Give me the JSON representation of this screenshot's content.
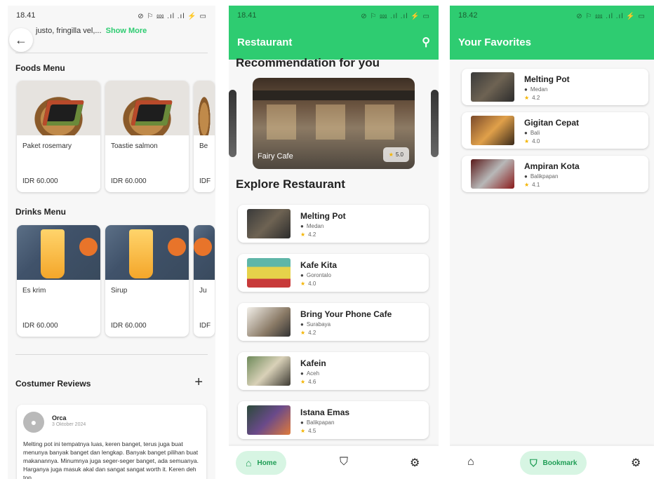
{
  "screen1": {
    "status_time": "18.41",
    "status_icons": "⊘ ⚐ ⅏ .ıl .ıl ⚡ ▭",
    "description_snippet": "justo, fringilla vel,...",
    "show_more": "Show More",
    "foods_title": "Foods Menu",
    "foods": [
      {
        "name": "Paket rosemary",
        "price": "IDR 60.000"
      },
      {
        "name": "Toastie salmon",
        "price": "IDR 60.000"
      },
      {
        "name": "Be",
        "price": "IDF"
      }
    ],
    "drinks_title": "Drinks Menu",
    "drinks": [
      {
        "name": "Es krim",
        "price": "IDR 60.000"
      },
      {
        "name": "Sirup",
        "price": "IDR 60.000"
      },
      {
        "name": "Ju",
        "price": "IDF"
      }
    ],
    "reviews_title": "Costumer Reviews",
    "review": {
      "name": "Orca",
      "date": "3 Oktober 2024",
      "text": "Melting pot ini tempatnya luas, keren banget, terus juga buat menunya banyak banget dan lengkap. Banyak banget pilihan buat makanannya. Minumnya juga seger-seger banget, ada semuanya. Harganya juga masuk akal dan sangat sangat worth it. Keren deh top"
    }
  },
  "screen2": {
    "status_time": "18.41",
    "app_title": "Restaurant",
    "recommendation_title": "Recommendation for you",
    "hero": {
      "name": "Fairy Cafe",
      "rating": "5.0"
    },
    "explore_title": "Explore Restaurant",
    "restaurants": [
      {
        "name": "Melting Pot",
        "city": "Medan",
        "rating": "4.2"
      },
      {
        "name": "Kafe Kita",
        "city": "Gorontalo",
        "rating": "4.0"
      },
      {
        "name": "Bring Your Phone Cafe",
        "city": "Surabaya",
        "rating": "4.2"
      },
      {
        "name": "Kafein",
        "city": "Aceh",
        "rating": "4.6"
      },
      {
        "name": "Istana Emas",
        "city": "Balikpapan",
        "rating": "4.5"
      }
    ],
    "nav": {
      "home": "Home"
    }
  },
  "screen3": {
    "status_time": "18.42",
    "app_title": "Your Favorites",
    "favorites": [
      {
        "name": "Melting Pot",
        "city": "Medan",
        "rating": "4.2"
      },
      {
        "name": "Gigitan Cepat",
        "city": "Bali",
        "rating": "4.0"
      },
      {
        "name": "Ampiran Kota",
        "city": "Balikpapan",
        "rating": "4.1"
      }
    ],
    "nav": {
      "bookmark": "Bookmark"
    }
  },
  "colors": {
    "accent": "#2ecc71",
    "star": "#f4b400",
    "nav_pill": "#d7f5e3"
  }
}
